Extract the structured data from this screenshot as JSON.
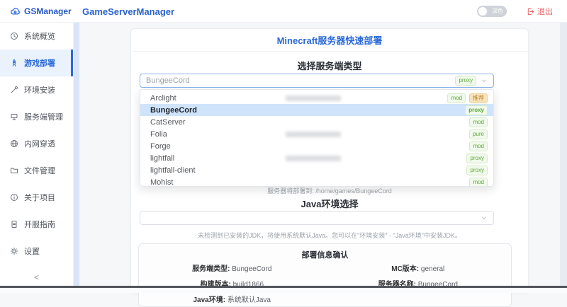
{
  "header": {
    "logo_text": "GSManager",
    "app_title": "GameServerManager",
    "theme_toggle_label": "深色",
    "logout_label": "退出"
  },
  "sidebar": {
    "items": [
      {
        "label": "系统概览"
      },
      {
        "label": "游戏部署"
      },
      {
        "label": "环境安装"
      },
      {
        "label": "服务端管理"
      },
      {
        "label": "内网穿透"
      },
      {
        "label": "文件管理"
      },
      {
        "label": "关于项目"
      },
      {
        "label": "开服指南"
      },
      {
        "label": "设置"
      }
    ],
    "collapse_label": "<"
  },
  "main": {
    "card_title": "Minecraft服务器快速部署",
    "server_type": {
      "title": "选择服务端类型",
      "select_value": "BungeeCord",
      "select_badge": "proxy",
      "deploy_path_hint": "服务器将部署到: /home/games/BungeeCord",
      "dropdown": {
        "options": [
          {
            "name": "Arclight",
            "badges": [
              {
                "text": "mod",
                "type": "success"
              },
              {
                "text": "推荐",
                "type": "warning"
              }
            ]
          },
          {
            "name": "BungeeCord",
            "badges": [
              {
                "text": "proxy",
                "type": "success"
              }
            ],
            "selected": true
          },
          {
            "name": "CatServer",
            "badges": [
              {
                "text": "mod",
                "type": "success"
              }
            ]
          },
          {
            "name": "Folia",
            "badges": [
              {
                "text": "pure",
                "type": "success"
              }
            ]
          },
          {
            "name": "Forge",
            "badges": [
              {
                "text": "mod",
                "type": "success"
              }
            ]
          },
          {
            "name": "lightfall",
            "badges": [
              {
                "text": "proxy",
                "type": "success"
              }
            ]
          },
          {
            "name": "lightfall-client",
            "badges": [
              {
                "text": "proxy",
                "type": "success"
              }
            ]
          },
          {
            "name": "Mohist",
            "badges": [
              {
                "text": "mod",
                "type": "success"
              }
            ]
          }
        ]
      }
    },
    "java_section": {
      "title": "Java环境选择",
      "hint": "未检测到已安装的JDK，将使用系统默认Java。您可以在\"环境安装\" - \"Java环境\"中安装JDK。"
    },
    "deploy_info": {
      "title": "部署信息确认",
      "fields": [
        {
          "label": "服务端类型:",
          "value": "BungeeCord"
        },
        {
          "label": "MC版本:",
          "value": "general"
        },
        {
          "label": "构建版本:",
          "value": "build1866"
        },
        {
          "label": "服务器名称:",
          "value": "BungeeCord"
        },
        {
          "label": "Java环境:",
          "value": "系统默认Java"
        }
      ]
    }
  },
  "colors": {
    "accent_blue": "#2a68d8",
    "success_green": "#67c23a",
    "warning_orange": "#e6a23c",
    "danger_red": "#e35d5d"
  }
}
